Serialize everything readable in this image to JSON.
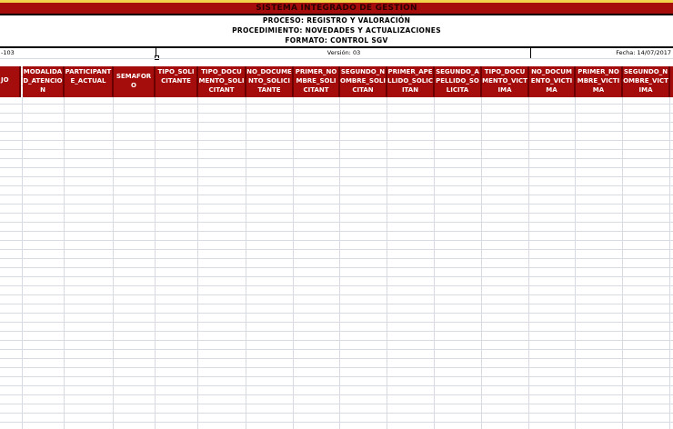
{
  "sheet": {
    "title": "SISTEMA INTEGRADO DE GESTION",
    "proceso": "PROCESO:  REGISTRO Y VALORACIÓN",
    "procedimiento": "PROCEDIMIENTO: NOVEDADES Y ACTUALIZACIONES",
    "formato": "FORMATO: CONTROL SGV",
    "codigo": "-103",
    "version": "Versión: 03",
    "fecha": "Fecha: 14/07/2017"
  },
  "colors": {
    "header_bg": "#a50c0c",
    "header_text": "#ffffff",
    "grid_line": "#d8dce2"
  },
  "columns": [
    {
      "label": "JO"
    },
    {
      "label": "MODALIDAD_ATENCION"
    },
    {
      "label": "PARTICIPANTE_ACTUAL"
    },
    {
      "label": "SEMAFORO"
    },
    {
      "label": "TIPO_SOLICITANTE"
    },
    {
      "label": "TIPO_DOCUMENTO_SOLICITANT"
    },
    {
      "label": "NO_DOCUMENTO_SOLICITANTE"
    },
    {
      "label": "PRIMER_NOMBRE_SOLICITANT"
    },
    {
      "label": "SEGUNDO_NOMBRE_SOLICITAN"
    },
    {
      "label": "PRIMER_APELLIDO_SOLICITAN"
    },
    {
      "label": "SEGUNDO_APELLIDO_SOLICITA"
    },
    {
      "label": "TIPO_DOCUMENTO_VICTIMA"
    },
    {
      "label": "NO_DOCUMENTO_VICTIMA"
    },
    {
      "label": "PRIMER_NOMBRE_VICTIMA"
    },
    {
      "label": "SEGUNDO_NOMBRE_VICTIMA"
    }
  ]
}
